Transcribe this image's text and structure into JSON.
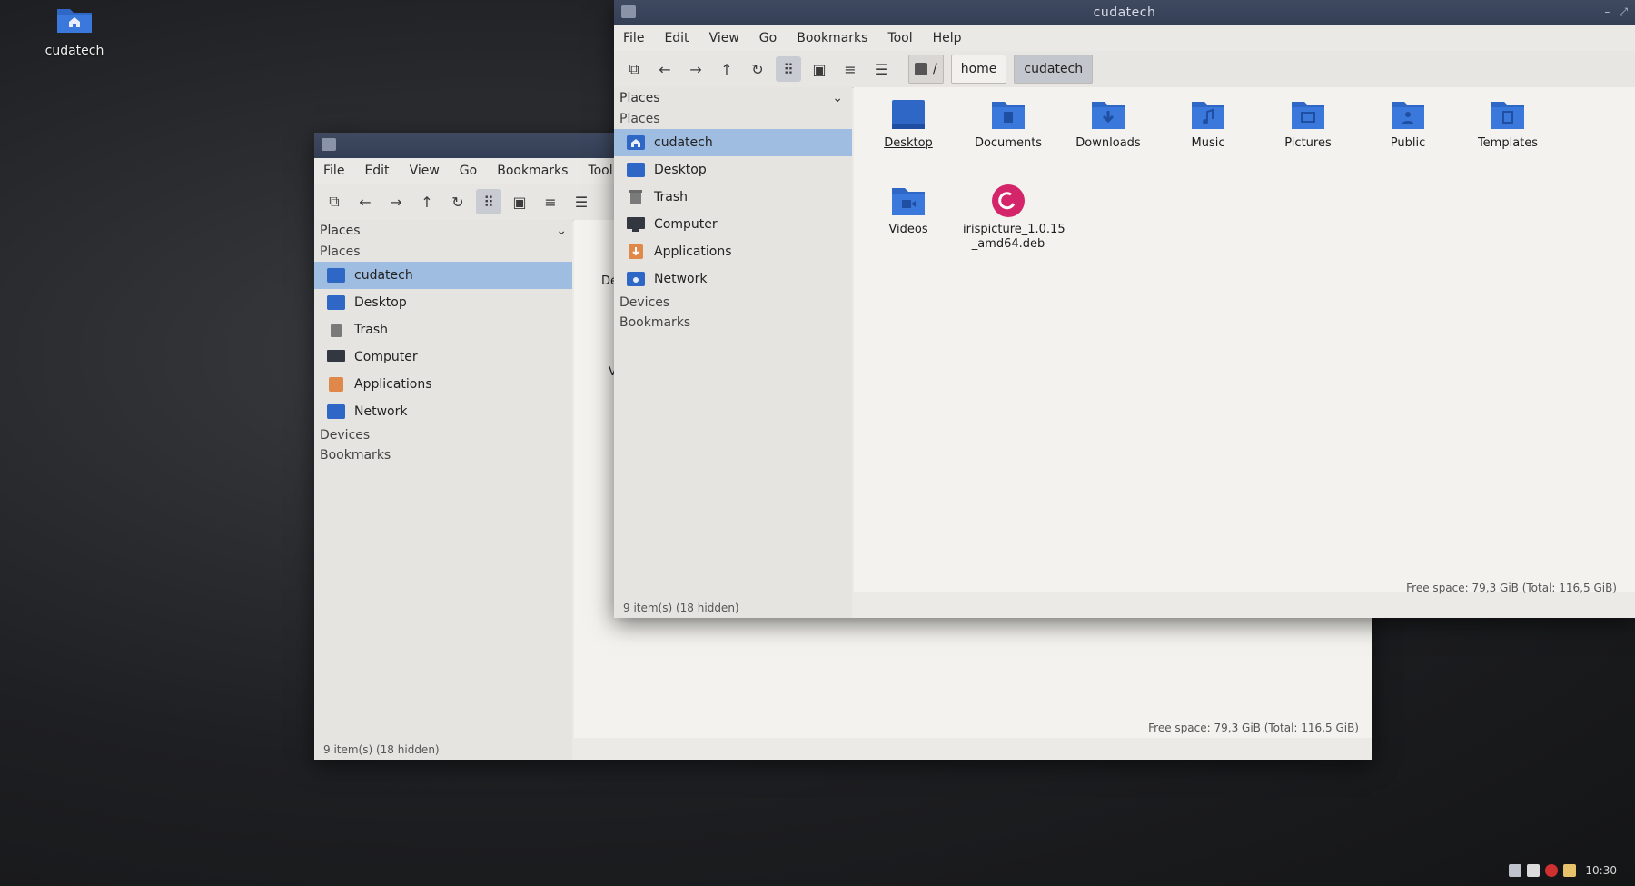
{
  "desktop": {
    "home_icon_label": "cudatech"
  },
  "colors": {
    "folder": "#2f67c6",
    "folder_dark": "#1f4fa3",
    "selection": "#9fbde0",
    "titlebar": "#3a4560"
  },
  "front_window": {
    "title": "cudatech",
    "menu": [
      "File",
      "Edit",
      "View",
      "Go",
      "Bookmarks",
      "Tool",
      "Help"
    ],
    "toolbar_icons": [
      "new-tab-icon",
      "back-icon",
      "forward-icon",
      "up-icon",
      "reload-icon",
      "icon-view-icon",
      "thumbnail-view-icon",
      "compact-view-icon",
      "list-view-icon"
    ],
    "path": {
      "root": "/",
      "segments": [
        "home",
        "cudatech"
      ]
    },
    "sidebar": {
      "dropdown_label": "Places",
      "places_header": "Places",
      "places": [
        {
          "label": "cudatech",
          "icon": "home-folder-icon",
          "selected": true
        },
        {
          "label": "Desktop",
          "icon": "desktop-folder-icon"
        },
        {
          "label": "Trash",
          "icon": "trash-icon"
        },
        {
          "label": "Computer",
          "icon": "computer-icon"
        },
        {
          "label": "Applications",
          "icon": "applications-icon"
        },
        {
          "label": "Network",
          "icon": "network-icon"
        }
      ],
      "devices_header": "Devices",
      "bookmarks_header": "Bookmarks"
    },
    "files": [
      {
        "name": "Desktop",
        "icon": "desktop-folder-icon"
      },
      {
        "name": "Documents",
        "icon": "documents-folder-icon"
      },
      {
        "name": "Downloads",
        "icon": "downloads-folder-icon"
      },
      {
        "name": "Music",
        "icon": "music-folder-icon"
      },
      {
        "name": "Pictures",
        "icon": "pictures-folder-icon"
      },
      {
        "name": "Public",
        "icon": "public-folder-icon"
      },
      {
        "name": "Templates",
        "icon": "templates-folder-icon"
      },
      {
        "name": "Videos",
        "icon": "videos-folder-icon"
      },
      {
        "name": "irispicture_1.0.15 _amd64.deb",
        "icon": "debian-package-icon"
      }
    ],
    "status_left": "9 item(s) (18 hidden)",
    "status_right": "Free space: 79,3 GiB (Total: 116,5 GiB)"
  },
  "back_window": {
    "menu": [
      "File",
      "Edit",
      "View",
      "Go",
      "Bookmarks",
      "Tool"
    ],
    "sidebar": {
      "dropdown_label": "Places",
      "places_header": "Places",
      "places": [
        {
          "label": "cudatech",
          "selected": true
        },
        {
          "label": "Desktop"
        },
        {
          "label": "Trash"
        },
        {
          "label": "Computer"
        },
        {
          "label": "Applications"
        },
        {
          "label": "Network"
        }
      ],
      "devices_header": "Devices",
      "bookmarks_header": "Bookmarks"
    },
    "partial_labels": [
      "De",
      "V"
    ],
    "status_left": "9 item(s) (18 hidden)",
    "status_right": "Free space: 79,3 GiB (Total: 116,5 GiB)"
  },
  "taskbar": {
    "clock": "10:30"
  }
}
